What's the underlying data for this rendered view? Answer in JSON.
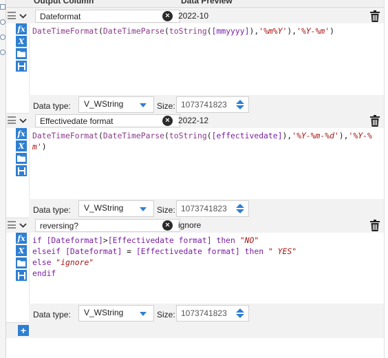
{
  "header": {
    "output_column": "Output Column",
    "data_preview": "Data Preview"
  },
  "labels": {
    "data_type": "Data type:",
    "size": "Size:"
  },
  "icons": {
    "formula": "fx",
    "variable": "X",
    "save": "save-icon",
    "open": "folder-icon",
    "delete": "trash-icon",
    "clear": "close-icon",
    "add": "+"
  },
  "colors": {
    "accent": "#2e7fd1",
    "function": "#8b3a8b",
    "field": "#7a1fa2",
    "string": "#a31515"
  },
  "fields": [
    {
      "name": "Dateformat",
      "preview": "2022-10",
      "expression": [
        [
          "fn",
          "DateTimeFormat"
        ],
        [
          "p",
          "("
        ],
        [
          "fn",
          "DateTimeParse"
        ],
        [
          "p",
          "("
        ],
        [
          "fn",
          "toString"
        ],
        [
          "p",
          "("
        ],
        [
          "fld",
          "[mmyyyy]"
        ],
        [
          "p",
          "),"
        ],
        [
          "str",
          "'%m%Y'"
        ],
        [
          "p",
          "),"
        ],
        [
          "str",
          "'%Y-%m'"
        ],
        [
          "p",
          ")"
        ]
      ],
      "data_type": "V_WString",
      "size": "1073741823"
    },
    {
      "name": "Effectivedate format",
      "preview": "2022-12",
      "expression": [
        [
          "fn",
          "DateTimeFormat"
        ],
        [
          "p",
          "("
        ],
        [
          "fn",
          "DateTimeParse"
        ],
        [
          "p",
          "("
        ],
        [
          "fn",
          "toString"
        ],
        [
          "p",
          "("
        ],
        [
          "fld",
          "[effectivedate]"
        ],
        [
          "p",
          "),"
        ],
        [
          "str",
          "'%Y-%m-%d'"
        ],
        [
          "p",
          "),"
        ],
        [
          "str",
          "'%Y-%m'"
        ],
        [
          "p",
          ")"
        ]
      ],
      "data_type": "V_WString",
      "size": "1073741823"
    },
    {
      "name": "reversing?",
      "preview": "ignore",
      "expression": [
        [
          "kw",
          "if "
        ],
        [
          "fld",
          "[Dateformat]"
        ],
        [
          "p",
          ">"
        ],
        [
          "fld",
          "[Effectivedate format]"
        ],
        [
          "kw",
          " then "
        ],
        [
          "str",
          "\"NO\""
        ],
        [
          "p",
          "\n"
        ],
        [
          "kw",
          "elseif "
        ],
        [
          "fld",
          "[Dateformat]"
        ],
        [
          "p",
          " = "
        ],
        [
          "fld",
          "[Effectivedate format]"
        ],
        [
          "kw",
          " then "
        ],
        [
          "str",
          "\" YES\""
        ],
        [
          "p",
          "\n"
        ],
        [
          "kw",
          "else "
        ],
        [
          "str",
          "\"ignore\""
        ],
        [
          "p",
          "\n"
        ],
        [
          "kw",
          "endif"
        ]
      ],
      "data_type": "V_WString",
      "size": "1073741823"
    }
  ]
}
